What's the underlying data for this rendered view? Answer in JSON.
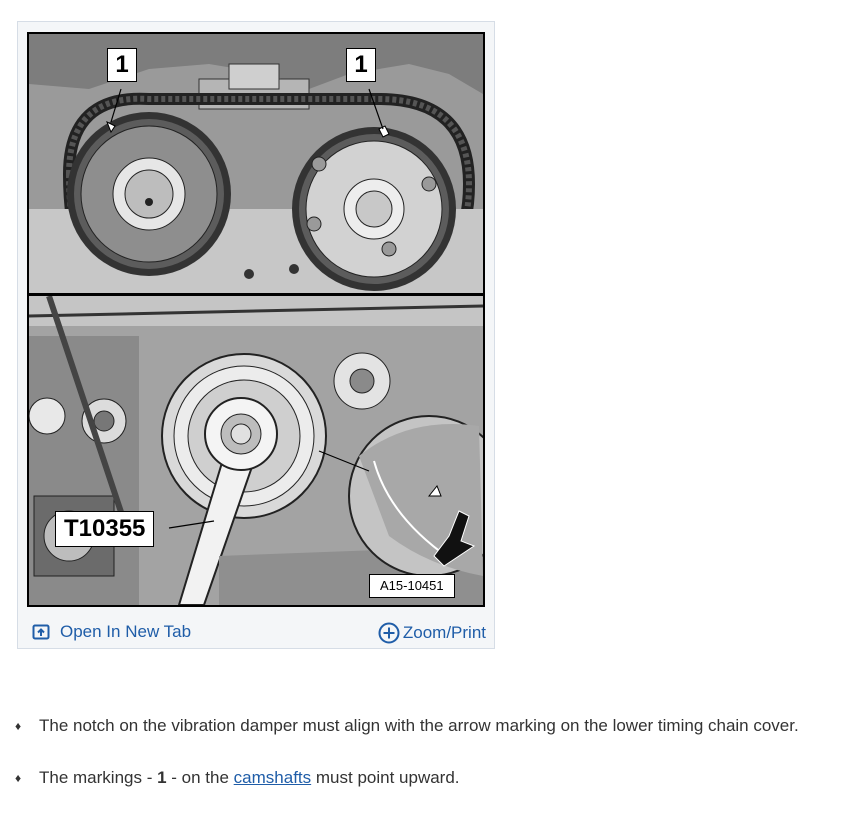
{
  "figure": {
    "callouts": [
      "1",
      "1"
    ],
    "tool_label": "T10355",
    "reference_code": "A15-10451",
    "open_tab_label": "Open In New Tab",
    "open_tab_icon": "open-in-new-tab-icon",
    "zoom_label": "Zoom/Print",
    "zoom_icon": "plus-circle-icon"
  },
  "instructions": [
    {
      "text": "The notch on the vibration damper must align with the arrow marking on the lower timing chain cover."
    },
    {
      "prefix": "The markings - ",
      "marker": "1",
      "middle": " - on the ",
      "link_text": "camshafts",
      "suffix": " must point upward."
    }
  ],
  "colors": {
    "link": "#1f5da8",
    "card_background": "#f4f6f8",
    "text": "#333333"
  }
}
